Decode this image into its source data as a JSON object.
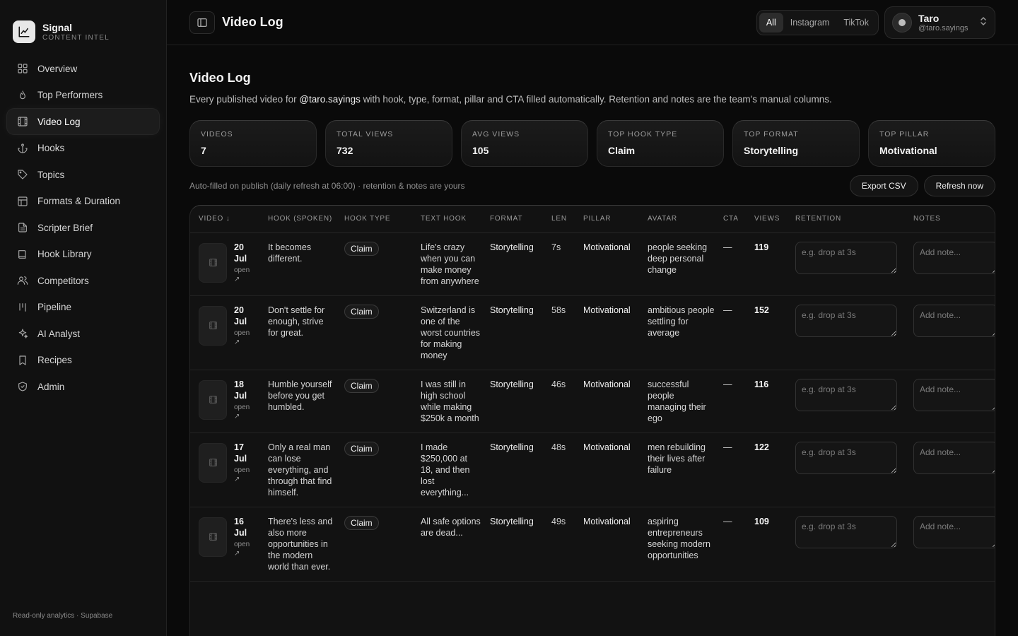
{
  "brand": {
    "name": "Signal",
    "subtitle": "CONTENT INTEL"
  },
  "nav": [
    {
      "label": "Overview",
      "icon": "grid-icon",
      "active": false
    },
    {
      "label": "Top Performers",
      "icon": "flame-icon",
      "active": false
    },
    {
      "label": "Video Log",
      "icon": "film-icon",
      "active": true
    },
    {
      "label": "Hooks",
      "icon": "anchor-icon",
      "active": false
    },
    {
      "label": "Topics",
      "icon": "tag-icon",
      "active": false
    },
    {
      "label": "Formats & Duration",
      "icon": "layout-icon",
      "active": false
    },
    {
      "label": "Scripter Brief",
      "icon": "file-text-icon",
      "active": false
    },
    {
      "label": "Hook Library",
      "icon": "book-icon",
      "active": false
    },
    {
      "label": "Competitors",
      "icon": "users-icon",
      "active": false
    },
    {
      "label": "Pipeline",
      "icon": "kanban-icon",
      "active": false
    },
    {
      "label": "AI Analyst",
      "icon": "sparkles-icon",
      "active": false
    },
    {
      "label": "Recipes",
      "icon": "bookmark-icon",
      "active": false
    },
    {
      "label": "Admin",
      "icon": "shield-icon",
      "active": false
    }
  ],
  "sidebar_footer": "Read-only analytics · Supabase",
  "topbar": {
    "title": "Video Log",
    "platforms": [
      "All",
      "Instagram",
      "TikTok"
    ],
    "platform_selected": "All",
    "account": {
      "name": "Taro",
      "handle": "@taro.sayings"
    }
  },
  "page": {
    "title": "Video Log",
    "desc_before": "Every published video for ",
    "desc_handle": "@taro.sayings",
    "desc_after": " with hook, type, format, pillar and CTA filled automatically. Retention and notes are the team's manual columns."
  },
  "stats": [
    {
      "label": "VIDEOS",
      "value": "7"
    },
    {
      "label": "TOTAL VIEWS",
      "value": "732"
    },
    {
      "label": "AVG VIEWS",
      "value": "105"
    },
    {
      "label": "TOP HOOK TYPE",
      "value": "Claim"
    },
    {
      "label": "TOP FORMAT",
      "value": "Storytelling"
    },
    {
      "label": "TOP PILLAR",
      "value": "Motivational"
    }
  ],
  "toolbar": {
    "note": "Auto-filled on publish (daily refresh at 06:00) · retention & notes are yours",
    "export_label": "Export CSV",
    "refresh_label": "Refresh now"
  },
  "table": {
    "headers": [
      "VIDEO ↓",
      "HOOK (SPOKEN)",
      "HOOK TYPE",
      "TEXT HOOK",
      "FORMAT",
      "LEN",
      "PILLAR",
      "AVATAR",
      "CTA",
      "VIEWS",
      "RETENTION",
      "NOTES"
    ],
    "open_label": "open ↗",
    "retention_placeholder": "e.g. drop at 3s",
    "notes_placeholder": "Add note...",
    "rows": [
      {
        "day": "20",
        "month": "Jul",
        "hook": "It becomes different.",
        "hook_type": "Claim",
        "text_hook": "Life's crazy when you can make money from anywhere",
        "format": "Storytelling",
        "len": "7s",
        "pillar": "Motivational",
        "avatar": "people seeking deep personal change",
        "cta": "—",
        "views": "119"
      },
      {
        "day": "20",
        "month": "Jul",
        "hook": "Don't settle for enough, strive for great.",
        "hook_type": "Claim",
        "text_hook": "Switzerland is one of the worst countries for making money",
        "format": "Storytelling",
        "len": "58s",
        "pillar": "Motivational",
        "avatar": "ambitious people settling for average",
        "cta": "—",
        "views": "152"
      },
      {
        "day": "18",
        "month": "Jul",
        "hook": "Humble yourself before you get humbled.",
        "hook_type": "Claim",
        "text_hook": "I was still in high school while making $250k a month",
        "format": "Storytelling",
        "len": "46s",
        "pillar": "Motivational",
        "avatar": "successful people managing their ego",
        "cta": "—",
        "views": "116"
      },
      {
        "day": "17",
        "month": "Jul",
        "hook": "Only a real man can lose everything, and through that find himself.",
        "hook_type": "Claim",
        "text_hook": "I made $250,000 at 18, and then lost everything...",
        "format": "Storytelling",
        "len": "48s",
        "pillar": "Motivational",
        "avatar": "men rebuilding their lives after failure",
        "cta": "—",
        "views": "122"
      },
      {
        "day": "16",
        "month": "Jul",
        "hook": "There's less and also more opportunities in the modern world than ever.",
        "hook_type": "Claim",
        "text_hook": "All safe options are dead...",
        "format": "Storytelling",
        "len": "49s",
        "pillar": "Motivational",
        "avatar": "aspiring entrepreneurs seeking modern opportunities",
        "cta": "—",
        "views": "109"
      }
    ]
  }
}
